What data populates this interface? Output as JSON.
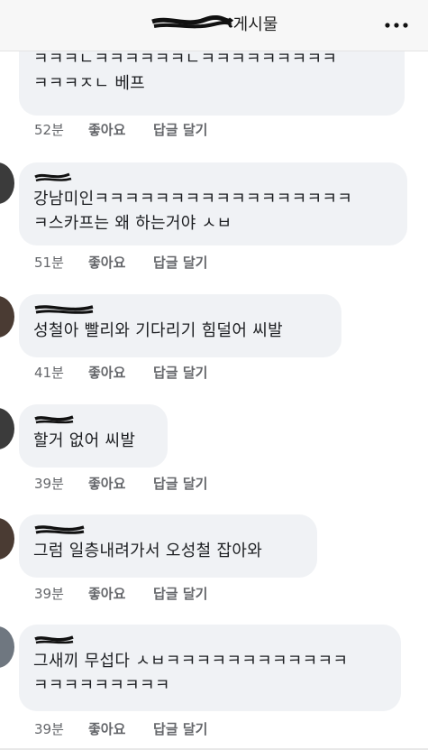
{
  "header": {
    "title_suffix": "게시물",
    "menu_icon": "more-horizontal-icon"
  },
  "actions": {
    "like_label": "좋아요",
    "reply_label": "답글 달기"
  },
  "comments": [
    {
      "text": "ㅋㅋㅋㄴㅋㅋㅋㅋㅋㅋㄴㅋㅋㅋㅋㅋㅋㅋㅋㅋ\nㅋㅋㅋㅈㄴ 베프",
      "time": "52분"
    },
    {
      "text": "강남미인ㅋㅋㅋㅋㅋㅋㅋㅋㅋㅋㅋㅋㅋㅋㅋㅋㅋ\nㅋ스카프는 왜 하는거야 ㅅㅂ",
      "time": "51분"
    },
    {
      "text": "성철아 빨리와 기다리기 힘덜어 씨발",
      "time": "41분"
    },
    {
      "text": "할거 없어 씨발",
      "time": "39분"
    },
    {
      "text": "그럼 일층내려가서 오성철 잡아와",
      "time": "39분"
    },
    {
      "text": "그새끼 무섭다 ㅅㅂㅋㅋㅋㅋㅋㅋㅋㅋㅋㅋㅋㅋ\nㅋㅋㅋㅋㅋㅋㅋㅋㅋ",
      "time": "39분"
    }
  ]
}
